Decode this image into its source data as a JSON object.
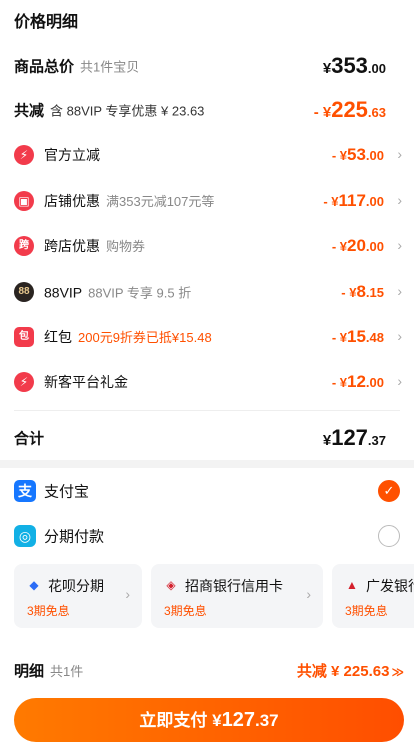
{
  "title": "价格明细",
  "goods_total": {
    "label": "商品总价",
    "sub": "共1件宝贝",
    "currency": "¥",
    "int": "353",
    "dec": ".00"
  },
  "discount_total": {
    "label": "共减",
    "sub": "含 88VIP 专享优惠 ¥ 23.63",
    "prefix": "- ¥",
    "int": "225",
    "dec": ".63"
  },
  "discounts": [
    {
      "icon": "lightning-icon",
      "glyph": "⚡",
      "label": "官方立减",
      "sub": "",
      "prefix": "- ¥",
      "int": "53",
      "dec": ".00"
    },
    {
      "icon": "shop-icon",
      "glyph": "▣",
      "label": "店铺优惠",
      "sub": "满353元减107元等",
      "prefix": "- ¥",
      "int": "117",
      "dec": ".00"
    },
    {
      "icon": "cross-store-icon",
      "glyph": "跨",
      "label": "跨店优惠",
      "sub": "购物券",
      "prefix": "- ¥",
      "int": "20",
      "dec": ".00"
    },
    {
      "icon": "88vip-icon",
      "glyph": "88",
      "label": "88VIP",
      "sub": "88VIP 专享 9.5 折",
      "prefix": "- ¥",
      "int": "8",
      "dec": ".15"
    },
    {
      "icon": "red-packet-icon",
      "glyph": "包",
      "label": "红包",
      "sub": "200元9折券已抵¥15.48",
      "prefix": "- ¥",
      "int": "15",
      "dec": ".48"
    },
    {
      "icon": "lightning-icon",
      "glyph": "⚡",
      "label": "新客平台礼金",
      "sub": "",
      "prefix": "- ¥",
      "int": "12",
      "dec": ".00"
    }
  ],
  "sum": {
    "label": "合计",
    "currency": "¥",
    "int": "127",
    "dec": ".37"
  },
  "payment": {
    "alipay": {
      "icon": "alipay-icon",
      "glyph": "支",
      "label": "支付宝",
      "selected": true
    },
    "installment": {
      "icon": "installment-icon",
      "glyph": "◎",
      "label": "分期付款",
      "selected": false
    },
    "cards": [
      {
        "icon": "huabei-icon",
        "glyph": "🏷",
        "name": "花呗分期",
        "note": "3期免息"
      },
      {
        "icon": "cmb-icon",
        "glyph": "◈",
        "name": "招商银行信用卡",
        "note": "3期免息"
      },
      {
        "icon": "cgb-icon",
        "glyph": "▲",
        "name": "广发银行",
        "note": "3期免息"
      }
    ]
  },
  "detail": {
    "label": "明细",
    "sub": "共1件",
    "right": "共减 ¥ 225.63",
    "arrow": "≫"
  },
  "pay_button": {
    "label": "立即支付",
    "currency": "¥",
    "int": "127",
    "dec": ".37"
  },
  "colors": {
    "accent": "#ff5000",
    "alipay": "#1677ff",
    "red_icon": "#f23b4b"
  }
}
